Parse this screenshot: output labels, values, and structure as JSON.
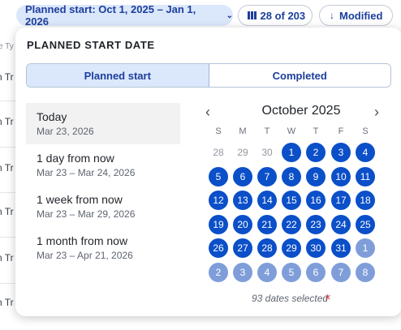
{
  "filters": {
    "date_chip": "Planned start: Oct 1, 2025 – Jan 1, 2026",
    "count_chip": "28 of 203",
    "sort_chip": "Modified"
  },
  "background": {
    "header": "e Ty",
    "row_label": "n Tr"
  },
  "panel": {
    "title": "PLANNED START DATE",
    "tabs": [
      "Planned start",
      "Completed"
    ],
    "presets": [
      {
        "label": "Today",
        "range": "Mar 23, 2026"
      },
      {
        "label": "1 day from now",
        "range": "Mar 23 – Mar 24, 2026"
      },
      {
        "label": "1 week from now",
        "range": "Mar 23 – Mar 29, 2026"
      },
      {
        "label": "1 month from now",
        "range": "Mar 23 – Apr 21, 2026"
      }
    ],
    "calendar": {
      "month": "October 2025",
      "prev": "‹",
      "next": "›",
      "weekdays": [
        "S",
        "M",
        "T",
        "W",
        "T",
        "F",
        "S"
      ],
      "weeks": [
        [
          "28",
          "29",
          "30",
          "1",
          "2",
          "3",
          "4"
        ],
        [
          "5",
          "6",
          "7",
          "8",
          "9",
          "10",
          "11"
        ],
        [
          "12",
          "13",
          "14",
          "15",
          "16",
          "17",
          "18"
        ],
        [
          "19",
          "20",
          "21",
          "22",
          "23",
          "24",
          "25"
        ],
        [
          "26",
          "27",
          "28",
          "29",
          "30",
          "31",
          "1"
        ],
        [
          "2",
          "3",
          "4",
          "5",
          "6",
          "7",
          "8"
        ]
      ]
    },
    "selection_text": "93 dates selected",
    "clear_icon": "×"
  },
  "colors": {
    "accent": "#1c3f9c",
    "selected_day": "#0b4fc9",
    "next_month_selected": "#7f9ed9",
    "chip_bg": "#dbe7fb",
    "clear": "#d8363a"
  }
}
